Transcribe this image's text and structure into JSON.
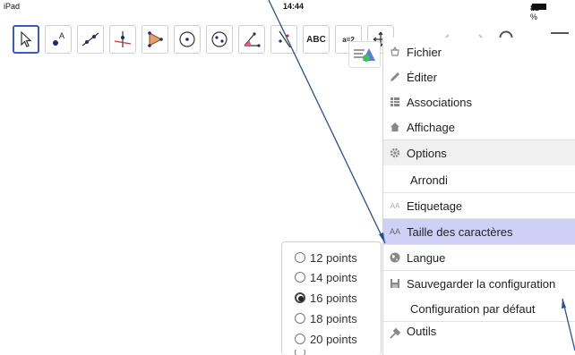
{
  "status_bar": {
    "device": "iPad",
    "time": "14:44",
    "battery": "82 %",
    "bluetooth": "✱"
  },
  "toolbar": {
    "tools": [
      {
        "name": "move-tool",
        "icon": "pointer-icon"
      },
      {
        "name": "point-tool",
        "icon": "point-icon"
      },
      {
        "name": "line-tool",
        "icon": "line-icon"
      },
      {
        "name": "perpendicular-tool",
        "icon": "perpendicular-icon"
      },
      {
        "name": "polygon-tool",
        "icon": "polygon-icon"
      },
      {
        "name": "circle-tool",
        "icon": "circle-icon"
      },
      {
        "name": "conic-tool",
        "icon": "ellipse-icon"
      },
      {
        "name": "angle-tool",
        "icon": "angle-icon"
      },
      {
        "name": "reflect-tool",
        "icon": "reflect-icon"
      },
      {
        "name": "text-tool",
        "label": "ABC"
      },
      {
        "name": "slider-tool",
        "label": "a=2"
      },
      {
        "name": "move-view-tool",
        "icon": "move-arrows-icon"
      }
    ]
  },
  "menu": {
    "fichier": "Fichier",
    "editer": "Éditer",
    "associations": "Associations",
    "affichage": "Affichage",
    "options": "Options",
    "arrondi": "Arrondi",
    "etiquetage": "Etiquetage",
    "taille": "Taille des caractères",
    "langue": "Langue",
    "sauvegarder": "Sauvegarder la configuration",
    "config_defaut": "Configuration par défaut",
    "outils": "Outils",
    "etiquetage_prefix": "AA",
    "taille_prefix": "AA"
  },
  "font_sizes": {
    "options": [
      "12 points",
      "14 points",
      "16 points",
      "18 points",
      "20 points"
    ],
    "selected": "16 points"
  },
  "colors": {
    "accent": "#3b58c9",
    "selected_row": "#cfd0f5",
    "arrow": "#2a4f9c"
  }
}
